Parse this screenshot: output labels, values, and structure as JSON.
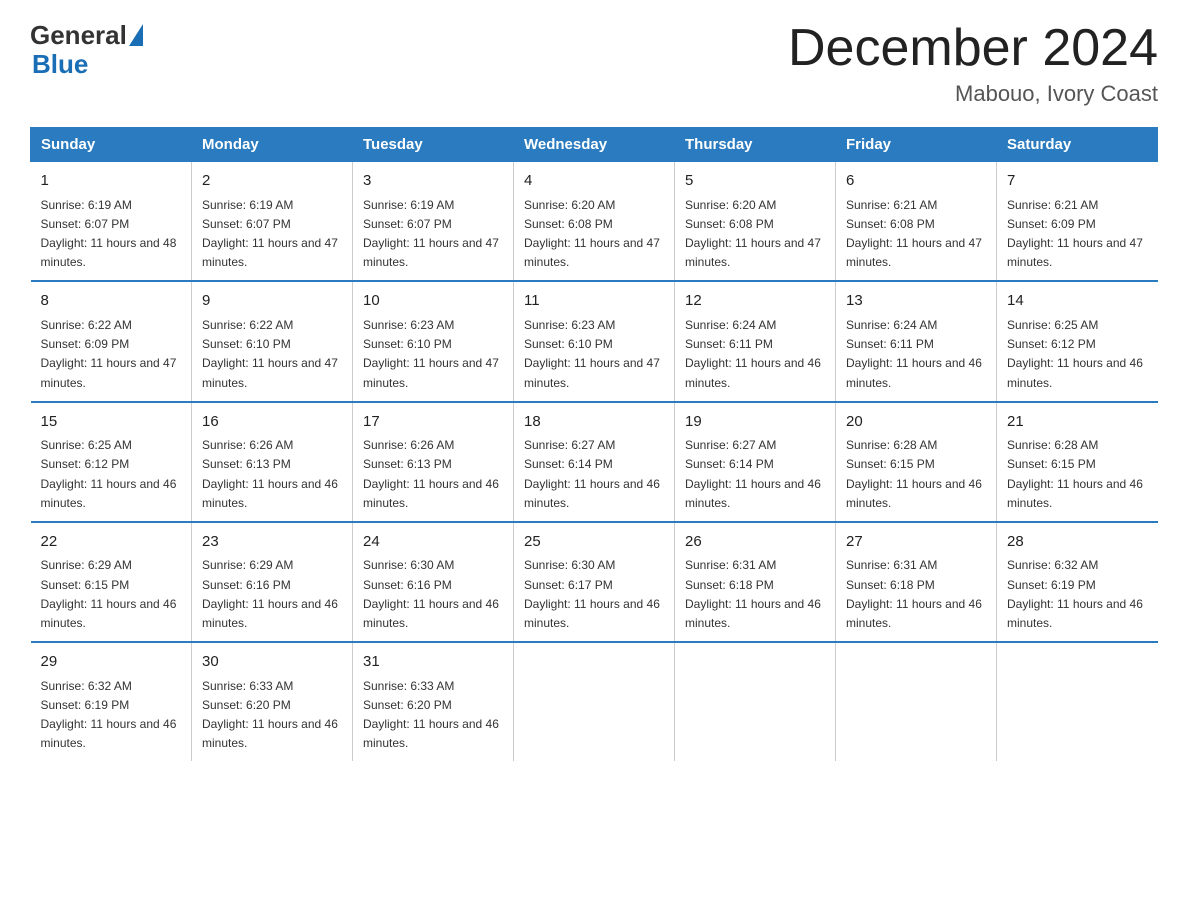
{
  "logo": {
    "general": "General",
    "blue": "Blue"
  },
  "title": "December 2024",
  "location": "Mabouo, Ivory Coast",
  "days_of_week": [
    "Sunday",
    "Monday",
    "Tuesday",
    "Wednesday",
    "Thursday",
    "Friday",
    "Saturday"
  ],
  "weeks": [
    [
      {
        "num": "1",
        "sunrise": "6:19 AM",
        "sunset": "6:07 PM",
        "daylight": "11 hours and 48 minutes."
      },
      {
        "num": "2",
        "sunrise": "6:19 AM",
        "sunset": "6:07 PM",
        "daylight": "11 hours and 47 minutes."
      },
      {
        "num": "3",
        "sunrise": "6:19 AM",
        "sunset": "6:07 PM",
        "daylight": "11 hours and 47 minutes."
      },
      {
        "num": "4",
        "sunrise": "6:20 AM",
        "sunset": "6:08 PM",
        "daylight": "11 hours and 47 minutes."
      },
      {
        "num": "5",
        "sunrise": "6:20 AM",
        "sunset": "6:08 PM",
        "daylight": "11 hours and 47 minutes."
      },
      {
        "num": "6",
        "sunrise": "6:21 AM",
        "sunset": "6:08 PM",
        "daylight": "11 hours and 47 minutes."
      },
      {
        "num": "7",
        "sunrise": "6:21 AM",
        "sunset": "6:09 PM",
        "daylight": "11 hours and 47 minutes."
      }
    ],
    [
      {
        "num": "8",
        "sunrise": "6:22 AM",
        "sunset": "6:09 PM",
        "daylight": "11 hours and 47 minutes."
      },
      {
        "num": "9",
        "sunrise": "6:22 AM",
        "sunset": "6:10 PM",
        "daylight": "11 hours and 47 minutes."
      },
      {
        "num": "10",
        "sunrise": "6:23 AM",
        "sunset": "6:10 PM",
        "daylight": "11 hours and 47 minutes."
      },
      {
        "num": "11",
        "sunrise": "6:23 AM",
        "sunset": "6:10 PM",
        "daylight": "11 hours and 47 minutes."
      },
      {
        "num": "12",
        "sunrise": "6:24 AM",
        "sunset": "6:11 PM",
        "daylight": "11 hours and 46 minutes."
      },
      {
        "num": "13",
        "sunrise": "6:24 AM",
        "sunset": "6:11 PM",
        "daylight": "11 hours and 46 minutes."
      },
      {
        "num": "14",
        "sunrise": "6:25 AM",
        "sunset": "6:12 PM",
        "daylight": "11 hours and 46 minutes."
      }
    ],
    [
      {
        "num": "15",
        "sunrise": "6:25 AM",
        "sunset": "6:12 PM",
        "daylight": "11 hours and 46 minutes."
      },
      {
        "num": "16",
        "sunrise": "6:26 AM",
        "sunset": "6:13 PM",
        "daylight": "11 hours and 46 minutes."
      },
      {
        "num": "17",
        "sunrise": "6:26 AM",
        "sunset": "6:13 PM",
        "daylight": "11 hours and 46 minutes."
      },
      {
        "num": "18",
        "sunrise": "6:27 AM",
        "sunset": "6:14 PM",
        "daylight": "11 hours and 46 minutes."
      },
      {
        "num": "19",
        "sunrise": "6:27 AM",
        "sunset": "6:14 PM",
        "daylight": "11 hours and 46 minutes."
      },
      {
        "num": "20",
        "sunrise": "6:28 AM",
        "sunset": "6:15 PM",
        "daylight": "11 hours and 46 minutes."
      },
      {
        "num": "21",
        "sunrise": "6:28 AM",
        "sunset": "6:15 PM",
        "daylight": "11 hours and 46 minutes."
      }
    ],
    [
      {
        "num": "22",
        "sunrise": "6:29 AM",
        "sunset": "6:15 PM",
        "daylight": "11 hours and 46 minutes."
      },
      {
        "num": "23",
        "sunrise": "6:29 AM",
        "sunset": "6:16 PM",
        "daylight": "11 hours and 46 minutes."
      },
      {
        "num": "24",
        "sunrise": "6:30 AM",
        "sunset": "6:16 PM",
        "daylight": "11 hours and 46 minutes."
      },
      {
        "num": "25",
        "sunrise": "6:30 AM",
        "sunset": "6:17 PM",
        "daylight": "11 hours and 46 minutes."
      },
      {
        "num": "26",
        "sunrise": "6:31 AM",
        "sunset": "6:18 PM",
        "daylight": "11 hours and 46 minutes."
      },
      {
        "num": "27",
        "sunrise": "6:31 AM",
        "sunset": "6:18 PM",
        "daylight": "11 hours and 46 minutes."
      },
      {
        "num": "28",
        "sunrise": "6:32 AM",
        "sunset": "6:19 PM",
        "daylight": "11 hours and 46 minutes."
      }
    ],
    [
      {
        "num": "29",
        "sunrise": "6:32 AM",
        "sunset": "6:19 PM",
        "daylight": "11 hours and 46 minutes."
      },
      {
        "num": "30",
        "sunrise": "6:33 AM",
        "sunset": "6:20 PM",
        "daylight": "11 hours and 46 minutes."
      },
      {
        "num": "31",
        "sunrise": "6:33 AM",
        "sunset": "6:20 PM",
        "daylight": "11 hours and 46 minutes."
      },
      null,
      null,
      null,
      null
    ]
  ]
}
